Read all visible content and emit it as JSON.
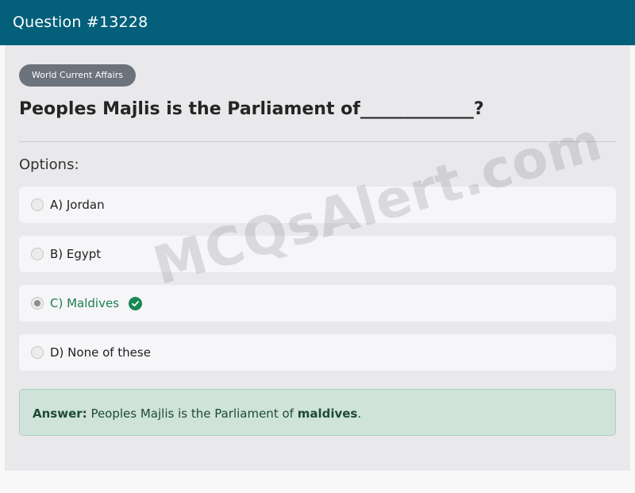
{
  "header": {
    "title": "Question #13228"
  },
  "category_badge": "World Current Affairs",
  "question": {
    "text": "Peoples Majlis is the Parliament of_____________?"
  },
  "options_label": "Options:",
  "options": [
    {
      "label": "A) Jordan",
      "selected": false,
      "correct": false
    },
    {
      "label": "B) Egypt",
      "selected": false,
      "correct": false
    },
    {
      "label": "C) Maldives",
      "selected": true,
      "correct": true
    },
    {
      "label": "D) None of these",
      "selected": false,
      "correct": false
    }
  ],
  "answer": {
    "prefix": "Answer:",
    "text": "Peoples Majlis is the Parliament of",
    "value": "maldives",
    "suffix": "."
  },
  "watermark": "MCQsAlert.com",
  "colors": {
    "header_bg": "#035f7a",
    "correct": "#198754",
    "answer_bg": "#cfe3da"
  },
  "icons": {
    "correct_mark": "check-circle-icon"
  }
}
